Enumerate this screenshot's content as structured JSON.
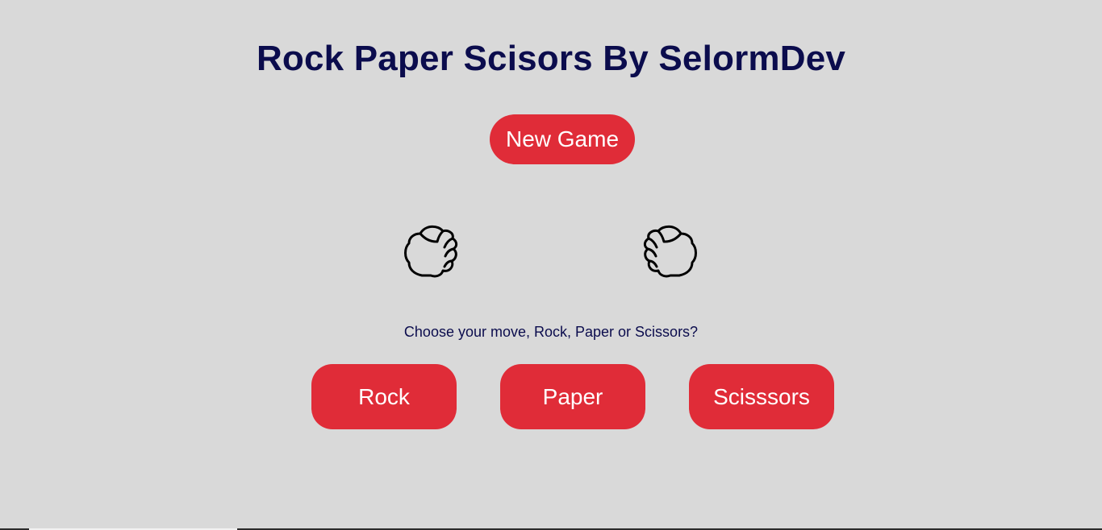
{
  "title": "Rock Paper Scisors By SelormDev",
  "new_game_label": "New Game",
  "player_hand_icon": "fist-icon",
  "computer_hand_icon": "fist-icon",
  "prompt": "Choose your move, Rock, Paper or Scissors?",
  "moves": [
    {
      "label": "Rock"
    },
    {
      "label": "Paper"
    },
    {
      "label": "Scisssors"
    }
  ],
  "colors": {
    "background": "#d9d9d9",
    "title": "#0b0c4d",
    "button": "#e02c38",
    "button_text": "#ffffff"
  }
}
